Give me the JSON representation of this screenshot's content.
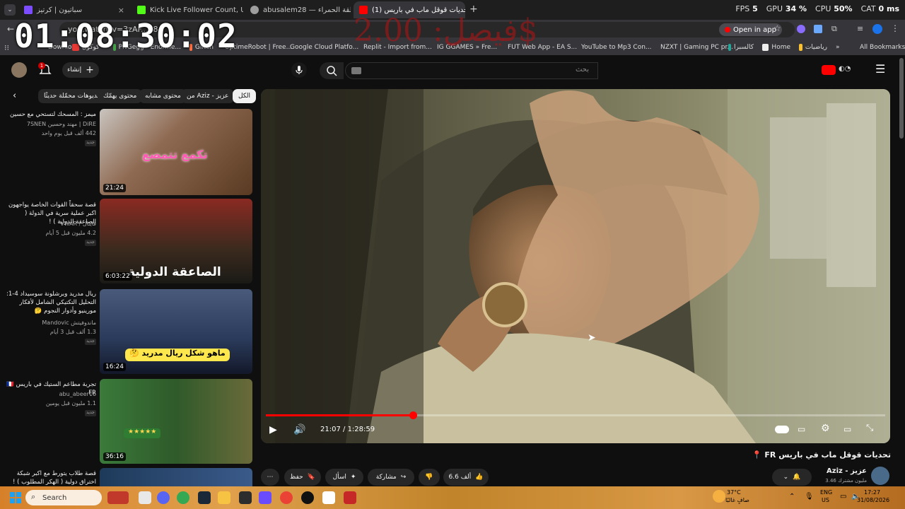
{
  "browser": {
    "tabs": [
      {
        "label": "سباتيون | كرتيز",
        "color": "#7c4dff"
      },
      {
        "label": "Kick Live Follower Count, Updat...",
        "color": "#53fc18"
      },
      {
        "label": "abusalem28 — المنطقة الحمراء",
        "color": "#9e9e9e"
      },
      {
        "label": "(1) تحديات قوقل ماب في باريس 📍FR",
        "color": "#ff0000"
      }
    ],
    "new_tab_label": "+",
    "close_label": "×",
    "stats": {
      "fps_label": "FPS",
      "fps_value": "5",
      "gpu_label": "GPU",
      "gpu_value": "34 %",
      "cpu_label": "CPU",
      "cpu_value": "50%",
      "cat_label": "CAT",
      "cat_value": "0 ms"
    },
    "url_fragment": "yo...watch?v=3zAF...38",
    "open_in_app": "Open in app",
    "bookmarks": [
      {
        "label": "Download",
        "color": "#ffb300"
      },
      {
        "label": "كوكول",
        "color": "#e53935"
      },
      {
        "label": "PNGegg - Enorme...",
        "color": "#43a047"
      },
      {
        "label": "Glitch",
        "color": "#ff7043"
      },
      {
        "label": "UptimeRobot | Free...",
        "color": "#4caf50"
      },
      {
        "label": "Google Cloud Platfo...",
        "color": "#9e9e9e"
      },
      {
        "label": "Replit - Import from...",
        "color": "#f26207"
      },
      {
        "label": "IG GGAMES » Fre...",
        "color": "#c62828"
      },
      {
        "label": "FUT Web App - EA S...",
        "color": "#fdd835"
      },
      {
        "label": "YouTube to Mp3 Con...",
        "color": "#1e88e5"
      },
      {
        "label": "NZXT | Gaming PC pr...",
        "color": "#424242"
      },
      {
        "label": "كالسبرا",
        "color": "#26a69a"
      },
      {
        "label": "Home",
        "color": "#eeeeee"
      },
      {
        "label": "رياضيات",
        "color": "#fbc02d"
      }
    ],
    "all_bookmarks": "All Bookmarks"
  },
  "overlay": {
    "clock": "01:08:30:02",
    "donation": "فيصل: 2.00$"
  },
  "youtube": {
    "create_label": "إنشاء",
    "notif_count": "1",
    "search_placeholder": "بحث",
    "chips": [
      "الكل",
      "من Aziz - عزيز",
      "محتوى مشابه",
      "محتوى يهمّك",
      "فيديوهات محمّلة حديثًا"
    ],
    "recommendations": [
      {
        "title": "ميمز : المسحك لتستحي مع حسين",
        "channel": "DiRE | مهند وحسين 7SNEN",
        "meta": "442 ألف  قبل يوم واحد",
        "badge": "جديد",
        "duration": "21:24",
        "thumb_text": "تكمع تتمصع",
        "thumb_bg": "#5a3a22"
      },
      {
        "title": "قصة سحقاً القوات الخاصة يواجهون اكبر عملية سرية في الدولة ( الصاعقة الدولية ) !",
        "channel": "فاينال / VWAR",
        "meta": "4.2 مليون  قبل 5 أيام",
        "badge": "جديد",
        "duration": "6:03:22",
        "thumb_text": "الصاعقة الدولية",
        "thumb_bg": "#3b2a1e"
      },
      {
        "title": "ريال مدريد وبرشلونة سوسيداد 4-1: التحليل التكتيكي الشامل لأفكار مورينيو وأدوار النجوم 🤔",
        "channel": "ماندوفيتش Mandovic",
        "meta": "1.3 ألف  قبل 3 أيام",
        "badge": "جديد",
        "duration": "16:24",
        "thumb_text": "ماهو شكل ريال مدريد 🤔",
        "thumb_bg": "#2a3a5a"
      },
      {
        "title": "تجربة مطاعم الستيك في باريس 🇫🇷FR",
        "channel": "abu_abeer16",
        "meta": "1.1 مليون  قبل يومين",
        "badge": "جديد",
        "duration": "36:16",
        "thumb_text": "★★★★★",
        "thumb_bg": "#2f5a2a"
      },
      {
        "title": "قصة طلاب يتورط مع اكبر شبكة اختراق دولية ( الهكر المطلوب ) !",
        "channel": "",
        "meta": "",
        "badge": "",
        "duration": "",
        "thumb_text": "",
        "thumb_bg": "#1e3a5a"
      }
    ],
    "player": {
      "current_time": "21:07",
      "duration": "1:28:59",
      "progress": 0.2374
    },
    "video_title": "تحديات قوقل ماب في باريس FR 📍",
    "channel_name": "Aziz - عزيز",
    "subscribers": "3.46 مليون مشترك",
    "actions": {
      "like": "6.6 ألف",
      "share": "مشاركة",
      "ask": "اسأل",
      "save": "حفظ",
      "more": "⋯"
    }
  },
  "taskbar": {
    "search": "Search",
    "weather_temp": "37°C",
    "weather_desc": "صافٍ غالبًا",
    "lang": "ENG",
    "region": "US",
    "time": "17:27",
    "date": "31/08/2026"
  }
}
